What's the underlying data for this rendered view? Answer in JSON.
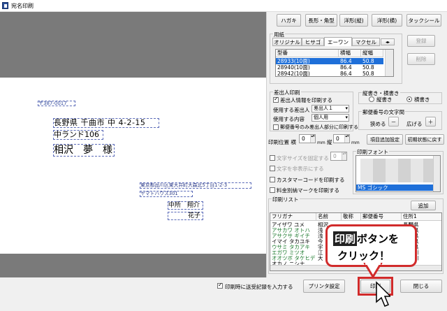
{
  "window": {
    "title": "宛名印刷",
    "icon": "document-icon"
  },
  "preview": {
    "postal": "〒387-0017",
    "address1": "長野県 千曲市 中 4-2-15",
    "address2": "中ランド106",
    "recipient": "相沢　夢　様",
    "sender_address": "東京都品川区東大井町大森北5丁目1-2-3",
    "sender_building": "ヤマトハウス301",
    "sender_name": "中所　翔介",
    "sender_name2": "花子"
  },
  "toolbar": {
    "buttons": [
      "ハガキ",
      "長形・角型",
      "洋形(縦)",
      "洋形(横)",
      "タックシール"
    ]
  },
  "paper": {
    "title": "用紙",
    "tabs": [
      "オリジナル",
      "ヒサゴ",
      "エーワン",
      "マクセル"
    ],
    "tab_scroll": "◂▸",
    "columns": [
      "型番",
      "横幅",
      "縦幅"
    ],
    "rows": [
      [
        "28933(10面)",
        "86.4",
        "50.8"
      ],
      [
        "28940(10面)",
        "86.4",
        "50.8"
      ],
      [
        "28942(10面)",
        "86.4",
        "50.8"
      ]
    ],
    "register_label": "登録",
    "delete_label": "削除"
  },
  "sender": {
    "title": "差出人印刷",
    "print_info": "差出人情報を印刷する",
    "use_sender_label": "使用する差出人",
    "use_sender_value": "差出人１",
    "use_content_label": "使用する内容",
    "use_content_value": "個人用",
    "postal_only": "郵便番号のみ差出人部分に印刷する"
  },
  "orientation": {
    "title": "縦書き・横書き",
    "vertical": "縦書き",
    "horizontal": "横書き"
  },
  "postal_spacing": {
    "title": "郵便番号の文字間",
    "narrow": "狭める",
    "widen": "広げる",
    "minus": "－",
    "plus": "＋"
  },
  "print_position": {
    "label": "印刷位置 横",
    "h_value": "0",
    "mm1": "mm",
    "v_label": "縦",
    "v_value": "0",
    "mm2": "mm",
    "add_item": "項目追加設定",
    "reset": "初期状態に戻す"
  },
  "options": {
    "fix_size": "文字サイズを固定する",
    "size_value": "0",
    "hide_text": "文字を非表示にする",
    "customer_barcode": "カスタマーコードを印刷する",
    "postage_mark": "料金別納マークを印刷する"
  },
  "font": {
    "title": "印刷フォント",
    "selected": "MS ゴシック"
  },
  "print_list": {
    "title": "印刷リスト",
    "add_label": "追加",
    "columns": [
      "フリガナ",
      "名前",
      "敬称",
      "郵便番号",
      "住所1"
    ],
    "rows": [
      [
        "アイザワ ユメ",
        "相沢",
        "",
        "",
        "長野県"
      ],
      [
        "アサカワ オトハ",
        "浅",
        "",
        "",
        "愛媛県"
      ],
      [
        "アサクサ ギイチ",
        "浅",
        "",
        "",
        "千葉県"
      ],
      [
        "イマイ タカユキ",
        "今",
        "",
        "",
        "千葉県"
      ],
      [
        "ウサミ タカアキ",
        "宇",
        "",
        "",
        "長野県"
      ],
      [
        "エガワ ミツオ",
        "江",
        "",
        "",
        "神奈川"
      ],
      [
        "オオツボ タケヒデ",
        "大",
        "",
        "",
        "神奈川"
      ],
      [
        "オカノ ニシナ",
        "",
        "",
        "",
        "山口"
      ]
    ]
  },
  "footer": {
    "record_history": "印刷時に送受記録を入力する",
    "printer_settings": "プリンタ設定",
    "print": "印刷",
    "close": "閉じる"
  },
  "callout": {
    "line1_bold": "印刷",
    "line1_rest": " ボタンを",
    "line2": "クリック！"
  },
  "colors": {
    "accent": "#1e6fd9",
    "callout_border": "#d12b2b",
    "address_box": "#5a6ab8"
  }
}
